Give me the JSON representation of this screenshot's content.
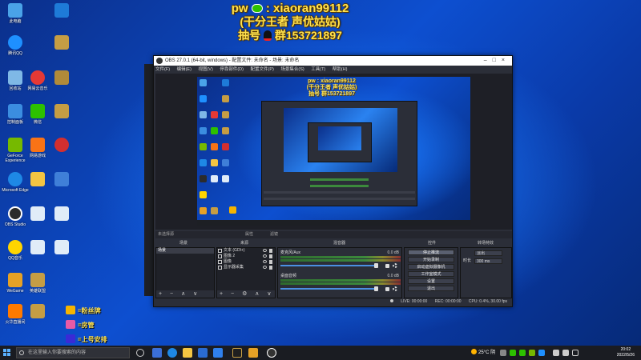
{
  "overlay": {
    "line1_prefix": "pw",
    "line1_sep": ":",
    "line1_handle": "xiaoran99112",
    "line2": "(干分王者 声优姑姑)",
    "line3_prefix": "抽号",
    "line3_group": "群153721897"
  },
  "desktop": {
    "icons": [
      {
        "label": "此电脑",
        "color": "#4aa3e8"
      },
      {
        "label": "腾讯QQ",
        "color": "#1e90ff"
      },
      {
        "label": "回收站",
        "color": "#7fb8e6"
      },
      {
        "label": "网易云音乐",
        "color": "#e53935"
      },
      {
        "label": "控制面板",
        "color": "#3b8de0"
      },
      {
        "label": "微信",
        "color": "#2dc100"
      },
      {
        "label": "GeForce Experience",
        "color": "#76b900"
      },
      {
        "label": "网易游戏",
        "color": "#f97316"
      },
      {
        "label": "Microsoft Edge",
        "color": "#1e88e5"
      },
      {
        "label": "英雄联盟",
        "color": "#c59d44"
      },
      {
        "label": "OBS Studio",
        "color": "#2b2b2b"
      },
      {
        "label": "QQ音乐",
        "color": "#ffd500"
      },
      {
        "label": "WeGame",
        "color": "#e5a126"
      },
      {
        "label": "火华直播间",
        "color": "#ff7a00"
      }
    ]
  },
  "badges": [
    {
      "label": "=粉丝牌",
      "color": "#f5b400"
    },
    {
      "label": "=房管",
      "color": "#e85aa6"
    },
    {
      "label": "=上号安排",
      "color": "#3a2ad6"
    }
  ],
  "obs": {
    "title": "OBS 27.0.1 (64-bit, windows) - 配置文件: 未命名 - 场景: 未命名",
    "menu": [
      "文件(F)",
      "编辑(E)",
      "视图(V)",
      "停靠部件(D)",
      "配置文件(P)",
      "场景集合(S)",
      "工具(T)",
      "帮助(H)"
    ],
    "mini_overlay": [
      "pw : xiaoran99112",
      "(干分王者 声优姑姑)",
      "抽号 群153721897"
    ],
    "toolbar": {
      "scene_name": "未选择源",
      "properties": "属性",
      "filters": "滤镜"
    },
    "docks": {
      "scenes": "场景",
      "sources": "来源",
      "mixer": "混音器",
      "controls": "控件",
      "transitions": "转场特效"
    },
    "scenes": [
      "场景"
    ],
    "sources": [
      "文本 (GDI+)",
      "图像 2",
      "图像",
      "显示器采集"
    ],
    "mixer": [
      {
        "name": "桌面音频",
        "db": "0.0 dB"
      },
      {
        "name": "麦克风/Aux",
        "db": "0.0 dB"
      }
    ],
    "controls": [
      "停止推流",
      "开始录制",
      "启动虚拟摄像机",
      "工作室模式",
      "设置",
      "退出"
    ],
    "transitions": {
      "type_label": "",
      "type_value": "淡出",
      "duration_label": "时长",
      "duration_value": "300 ms"
    },
    "footer_buttons": "+ − ∧ ∨",
    "status": {
      "live": "LIVE: 00:00:00",
      "rec": "REC: 00:00:00",
      "cpu": "CPU: 0.4%, 30.00 fps"
    }
  },
  "taskbar": {
    "search_placeholder": "在这里输入你要搜索的内容",
    "weather": "25°C 阴",
    "time": "20:02",
    "date": "2022/5/26"
  }
}
